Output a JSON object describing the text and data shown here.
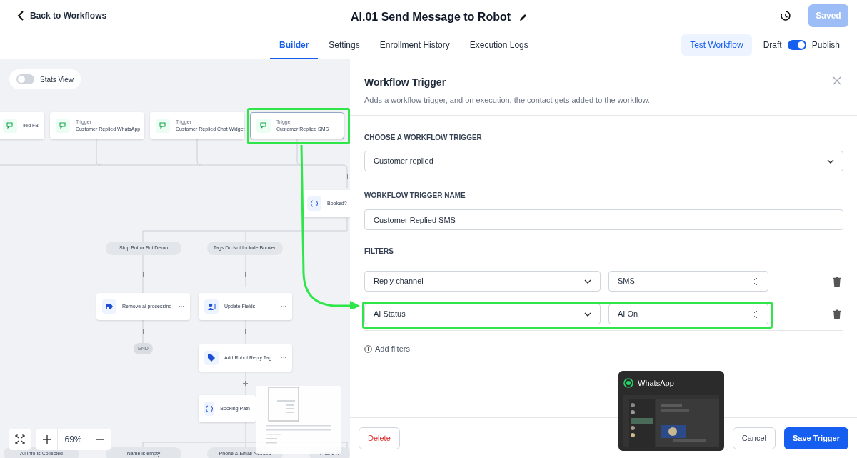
{
  "header": {
    "back_link": "Back to Workflows",
    "title": "AI.01 Send Message to Robot",
    "saved_button": {
      "label": "Saved",
      "disabled": true
    }
  },
  "tabs": [
    {
      "label": "Builder",
      "selected": true
    },
    {
      "label": "Settings",
      "selected": false
    },
    {
      "label": "Enrollment History",
      "selected": false
    },
    {
      "label": "Execution Logs",
      "selected": false
    }
  ],
  "test_button": "Test Workflow",
  "publish_toggle": {
    "off_label": "Draft",
    "on_label": "Publish",
    "on": true
  },
  "canvas": {
    "stats_toggle": {
      "label": "Stats View",
      "on": false
    },
    "nodes": [
      {
        "kind": "trigger",
        "label": "lied FB",
        "selected": false
      },
      {
        "kind": "trigger",
        "title": "Trigger",
        "label": "Customer Replied WhatsApp",
        "selected": false
      },
      {
        "kind": "trigger",
        "title": "Trigger",
        "label": "Customer Replied Chat Widget",
        "selected": false
      },
      {
        "kind": "trigger",
        "title": "Trigger",
        "label": "Customer Replied SMS",
        "selected": true
      },
      {
        "kind": "condition",
        "label": "Booked?"
      },
      {
        "kind": "pill",
        "label": "Stop Bot or Bot Demo"
      },
      {
        "kind": "pill",
        "label": "Tags Do Not Include Booked"
      },
      {
        "kind": "action",
        "label": "Remove ai processing",
        "menu": "···"
      },
      {
        "kind": "action",
        "label": "Update Fields",
        "menu": "···"
      },
      {
        "kind": "end",
        "label": "END"
      },
      {
        "kind": "action",
        "label": "Add Robot Reply Tag",
        "menu": "···"
      },
      {
        "kind": "condition",
        "label": "Booking Path"
      },
      {
        "kind": "pill",
        "label": "All Info Is Collected"
      },
      {
        "kind": "pill",
        "label": "Name is empty"
      },
      {
        "kind": "pill",
        "label": "Phone & Email Needed"
      },
      {
        "kind": "pill",
        "label": "Phone N"
      }
    ],
    "zoom_level": "69%"
  },
  "panel": {
    "title": "Workflow Trigger",
    "subtitle": "Adds a workflow trigger, and on execution, the contact gets added to the workflow.",
    "trigger_label": "CHOOSE A WORKFLOW TRIGGER",
    "trigger_value": "Customer replied",
    "name_label": "WORKFLOW TRIGGER NAME",
    "name_value": "Customer Replied SMS",
    "filters_label": "FILTERS",
    "filters": [
      {
        "field": "Reply channel",
        "value": "SMS",
        "highlighted": false
      },
      {
        "field": "AI Status",
        "value": "AI On",
        "highlighted": true
      }
    ],
    "add_filters": "Add filters",
    "delete_button": "Delete",
    "cancel_button": "Cancel",
    "save_button": "Save Trigger"
  },
  "preview": {
    "title": "WhatsApp"
  }
}
